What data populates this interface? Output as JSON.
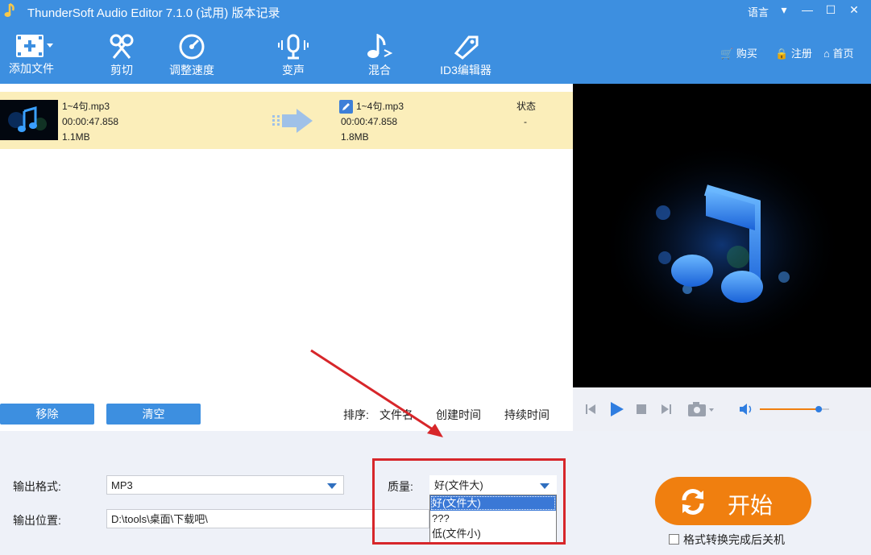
{
  "window": {
    "title": "ThunderSoft Audio Editor 7.1.0 (试用) 版本记录",
    "language_label": "语言",
    "controls": [
      "dropdown",
      "minimize",
      "maximize",
      "close"
    ]
  },
  "toolbar": {
    "items": [
      {
        "label": "添加文件",
        "icon": "film-add-icon"
      },
      {
        "label": "剪切",
        "icon": "scissors-icon"
      },
      {
        "label": "调整速度",
        "icon": "speedometer-icon"
      },
      {
        "label": "变声",
        "icon": "microphone-icon"
      },
      {
        "label": "混合",
        "icon": "music-note-icon"
      },
      {
        "label": "ID3编辑器",
        "icon": "tag-icon"
      }
    ],
    "right_links": [
      {
        "label": "购买",
        "icon": "cart-icon"
      },
      {
        "label": "注册",
        "icon": "lock-icon"
      },
      {
        "label": "首页",
        "icon": "home-icon"
      }
    ]
  },
  "file_list": {
    "rows": [
      {
        "source": {
          "name": "1~4句.mp3",
          "duration": "00:00:47.858",
          "size": "1.1MB"
        },
        "output": {
          "name": "1~4句.mp3",
          "duration": "00:00:47.858",
          "size": "1.8MB"
        },
        "status_header": "状态",
        "status_value": "-"
      }
    ]
  },
  "actions": {
    "remove": "移除",
    "clear": "清空"
  },
  "sort": {
    "label": "排序:",
    "options": [
      "文件名",
      "创建时间",
      "持续时间"
    ]
  },
  "player": {
    "volume": 0.85
  },
  "settings": {
    "format_label": "输出格式:",
    "format_value": "MP3",
    "location_label": "输出位置:",
    "location_value": "D:\\tools\\桌面\\下载吧\\",
    "quality_label": "质量:",
    "quality_value": "好(文件大)",
    "quality_options": [
      "好(文件大)",
      "???",
      "低(文件小)"
    ],
    "quality_selected_index": 0
  },
  "start_button": {
    "label": "开始"
  },
  "shutdown_checkbox": {
    "label": "格式转换完成后关机",
    "checked": false
  },
  "colors": {
    "accent": "#3d8fe0",
    "row_highlight": "#fbeeba",
    "start": "#f07f0f",
    "annotation": "#d7262a"
  }
}
